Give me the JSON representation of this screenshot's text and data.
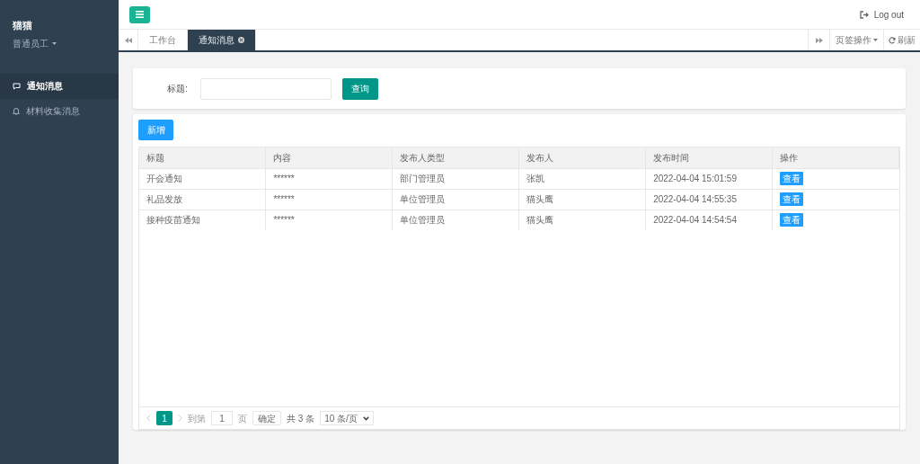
{
  "sidebar": {
    "user_name": "猫猫",
    "role": "普通员工",
    "items": [
      {
        "label": "通知消息",
        "selected": true
      },
      {
        "label": "材料收集消息",
        "selected": false
      }
    ]
  },
  "topbar": {
    "logout": "Log out"
  },
  "tabs": {
    "items": [
      {
        "label": "工作台",
        "selected": false,
        "closable": false
      },
      {
        "label": "通知消息",
        "selected": true,
        "closable": true
      }
    ],
    "page_actions": "页签操作",
    "refresh": "刷新"
  },
  "search": {
    "label": "标题:",
    "button": "查询"
  },
  "add_button": "新增",
  "table": {
    "columns": [
      "标题",
      "内容",
      "发布人类型",
      "发布人",
      "发布时间",
      "操作"
    ],
    "rows": [
      {
        "cells": [
          "开会通知",
          "******",
          "部门管理员",
          "张凯",
          "2022-04-04 15:01:59"
        ],
        "action": "查看"
      },
      {
        "cells": [
          "礼品发放",
          "******",
          "单位管理员",
          "猫头鹰",
          "2022-04-04 14:55:35"
        ],
        "action": "查看"
      },
      {
        "cells": [
          "接种疫苗通知",
          "******",
          "单位管理员",
          "猫头鹰",
          "2022-04-04 14:54:54"
        ],
        "action": "查看"
      }
    ]
  },
  "pagination": {
    "pages": [
      {
        "label": "1",
        "selected": true
      }
    ],
    "goto_label": "到第",
    "goto_value": "1",
    "page_unit": "页",
    "confirm": "确定",
    "total": "共 3 条",
    "page_size": "10 条/页"
  }
}
